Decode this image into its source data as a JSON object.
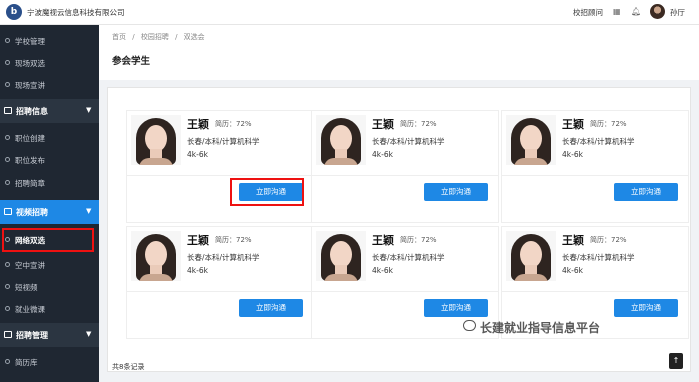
{
  "header": {
    "company": "宁波魔视云信息科技有限公司",
    "consultant_link": "校招顾问",
    "menu_icon": "grid-icon",
    "bell_icon": "bell-icon",
    "username": "孙厅"
  },
  "sidebar": {
    "items_top": [
      "学校管理",
      "现场双选",
      "现场宣讲"
    ],
    "group_recruit_info": "招聘信息",
    "items_recruit_info": [
      "职位创建",
      "职位发布",
      "招聘简章"
    ],
    "group_video": "视频招聘",
    "items_video": [
      "网络双选",
      "空中宣讲",
      "短视频",
      "就业微课"
    ],
    "group_manage": "招聘管理",
    "items_manage": [
      "简历库"
    ]
  },
  "breadcrumb": [
    "首页",
    "/",
    "校园招聘",
    "/",
    "双选会"
  ],
  "page_title": "参会学生",
  "cards": [
    {
      "name": "王颖",
      "resume": "简历：72%",
      "info": "长春/本科/计算机科学",
      "salary": "4k-6k",
      "button": "立即沟通"
    },
    {
      "name": "王颖",
      "resume": "简历：72%",
      "info": "长春/本科/计算机科学",
      "salary": "4k-6k",
      "button": "立即沟通"
    },
    {
      "name": "王颖",
      "resume": "简历：72%",
      "info": "长春/本科/计算机科学",
      "salary": "4k-6k",
      "button": "立即沟通"
    },
    {
      "name": "王颖",
      "resume": "简历：72%",
      "info": "长春/本科/计算机科学",
      "salary": "4k-6k",
      "button": "立即沟通"
    },
    {
      "name": "王颖",
      "resume": "简历：72%",
      "info": "长春/本科/计算机科学",
      "salary": "4k-6k",
      "button": "立即沟通"
    },
    {
      "name": "王颖",
      "resume": "简历：72%",
      "info": "长春/本科/计算机科学",
      "salary": "4k-6k",
      "button": "立即沟通"
    }
  ],
  "total": "共8条记录",
  "watermark": "长建就业指导信息平台",
  "fab": "↑",
  "colors": {
    "accent": "#1e88e5",
    "sidebar": "#1f2732",
    "highlight": "#e11111"
  }
}
